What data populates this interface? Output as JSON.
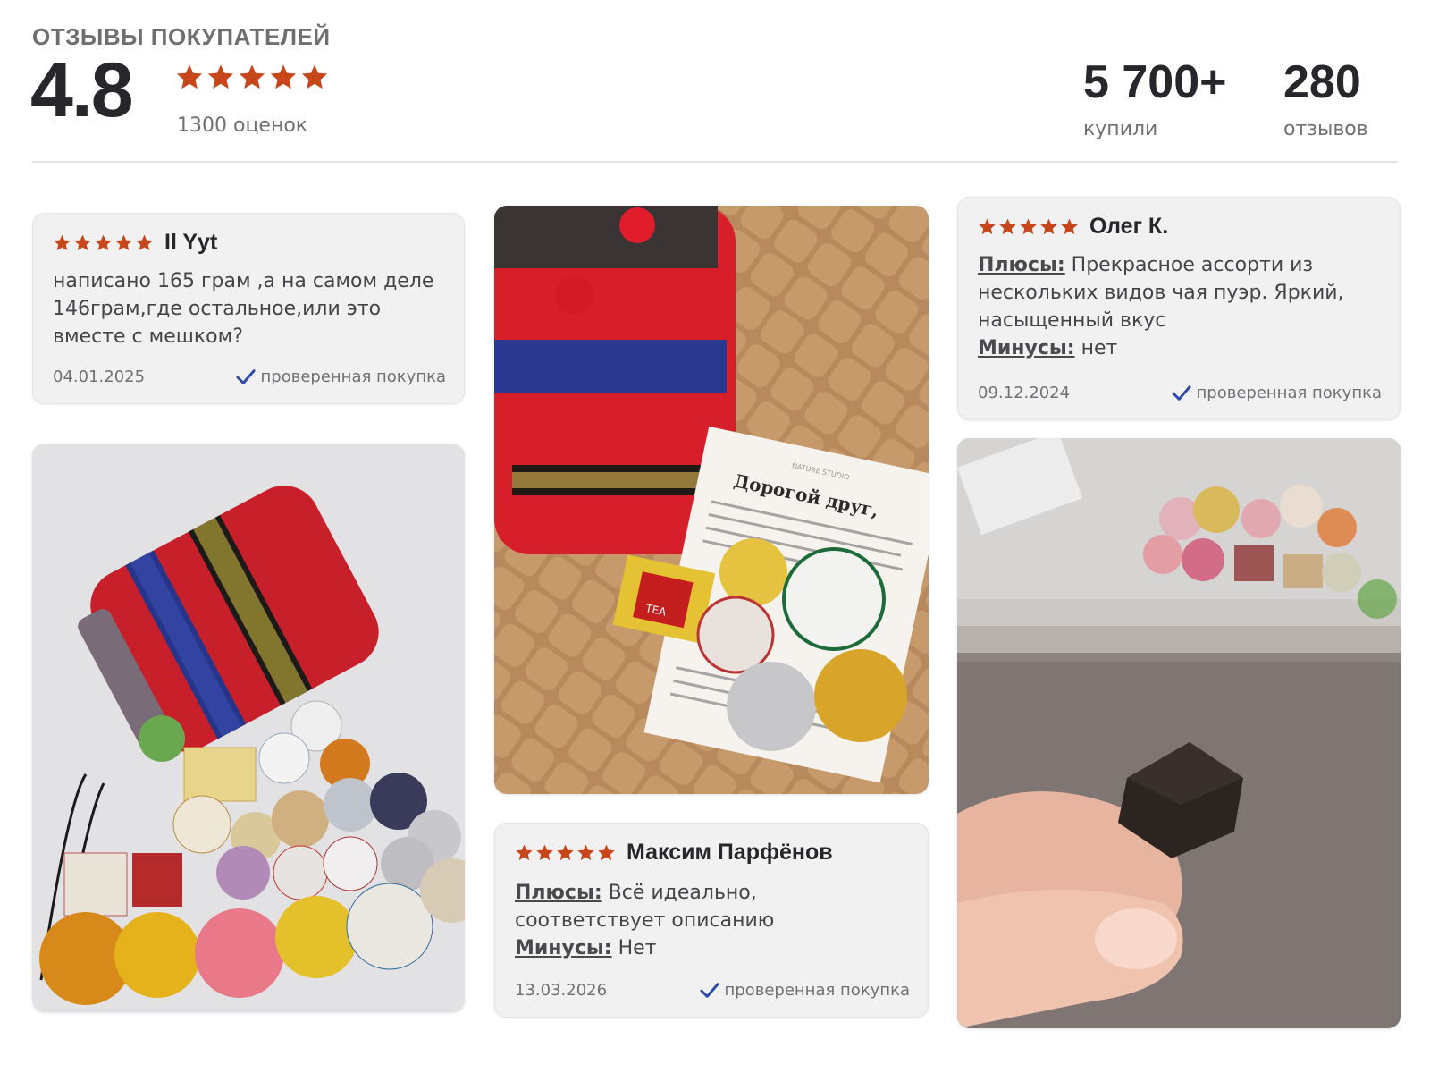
{
  "header": {
    "title": "ОТЗЫВЫ ПОКУПАТЕЛЕЙ",
    "rating": "4.8",
    "ratings_count": "1300 оценок",
    "bought_value": "5 700+",
    "bought_label": "купили",
    "reviews_value": "280",
    "reviews_label": "отзывов",
    "stars": 5
  },
  "colors": {
    "star": "#c8471a",
    "verified_check": "#2c4aa8"
  },
  "reviews": [
    {
      "author": "Il Yyt",
      "stars": 5,
      "text": "написано 165 грам ,а на самом деле 146грам,где остальное,или это вместе с мешком?",
      "date": "04.01.2025",
      "verified": "проверенная покупка"
    },
    {
      "author": "Максим Парфёнов",
      "stars": 5,
      "plus_label": "Плюсы:",
      "plus": "Всё идеально, соответствует описанию",
      "minus_label": "Минусы:",
      "minus": "Нет",
      "date": "13.03.2026",
      "verified": "проверенная покупка"
    },
    {
      "author": "Олег К.",
      "stars": 5,
      "plus_label": "Плюсы:",
      "plus": "Прекрасное ассорти из нескольких видов чая пуэр. Яркий, насыщенный вкус",
      "minus_label": "Минусы:",
      "minus": "нет",
      "date": "09.12.2024",
      "verified": "проверенная покупка"
    }
  ],
  "photos": [
    {
      "name": "review-photo-bag-and-tea-assortment"
    },
    {
      "name": "review-photo-bag-with-note"
    },
    {
      "name": "review-photo-tea-piece-in-hand"
    }
  ],
  "photo_text": {
    "note_heading": "Дорогой друг,",
    "tea_mark": "TEA",
    "brand": "NATURE STUDIO"
  }
}
